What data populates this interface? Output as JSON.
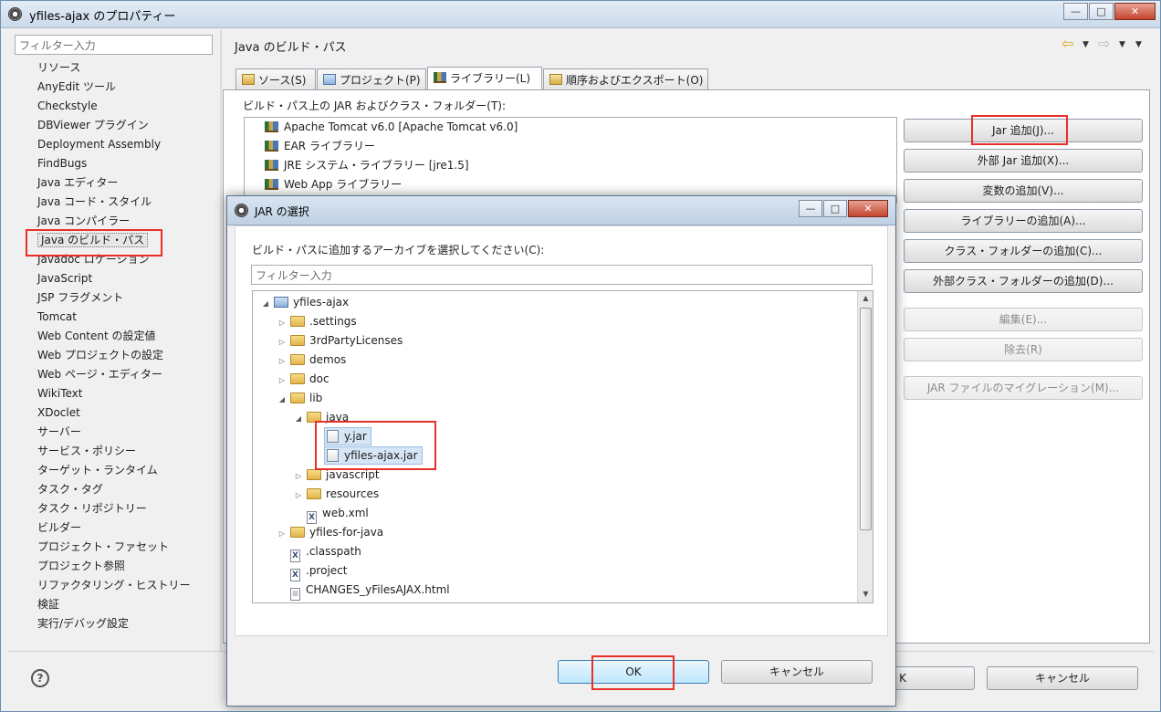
{
  "main_window": {
    "title": "yfiles-ajax のプロパティー",
    "left_filter_placeholder": "フィルター入力",
    "nav_items": [
      "リソース",
      "AnyEdit ツール",
      "Checkstyle",
      "DBViewer プラグイン",
      "Deployment Assembly",
      "FindBugs",
      "Java エディター",
      "Java コード・スタイル",
      "Java コンパイラー",
      "Java のビルド・パス",
      "Javadoc ロケーション",
      "JavaScript",
      "JSP フラグメント",
      "Tomcat",
      "Web Content の設定値",
      "Web プロジェクトの設定",
      "Web ページ・エディター",
      "WikiText",
      "XDoclet",
      "サーバー",
      "サービス・ポリシー",
      "ターゲット・ランタイム",
      "タスク・タグ",
      "タスク・リポジトリー",
      "ビルダー",
      "プロジェクト・ファセット",
      "プロジェクト参照",
      "リファクタリング・ヒストリー",
      "検証",
      "実行/デバッグ設定"
    ],
    "selected_nav": "Java のビルド・パス",
    "page_title": "Java のビルド・パス",
    "tabs": [
      "ソース(S)",
      "プロジェクト(P)",
      "ライブラリー(L)",
      "順序およびエクスポート(O)"
    ],
    "active_tab": "ライブラリー(L)",
    "classpath_label": "ビルド・パス上の JAR およびクラス・フォルダー(T):",
    "libraries": [
      "Apache Tomcat v6.0 [Apache Tomcat v6.0]",
      "EAR ライブラリー",
      "JRE システム・ライブラリー [jre1.5]",
      "Web App ライブラリー"
    ],
    "buttons": {
      "add_jars": "Jar 追加(J)...",
      "add_external_jars": "外部 Jar 追加(X)...",
      "add_variable": "変数の追加(V)...",
      "add_library": "ライブラリーの追加(A)...",
      "add_class_folder": "クラス・フォルダーの追加(C)...",
      "add_external_class_folder": "外部クラス・フォルダーの追加(D)...",
      "edit": "編集(E)...",
      "remove": "除去(R)",
      "migrate_jar": "JAR ファイルのマイグレーション(M)...",
      "ok_partial": "K",
      "cancel": "キャンセル"
    },
    "help_glyph": "?",
    "caption_buttons": {
      "minimize": "—",
      "maximize": "□",
      "close": "✕"
    }
  },
  "dialog": {
    "title": "JAR の選択",
    "prompt": "ビルド・パスに追加するアーカイブを選択してください(C):",
    "filter_placeholder": "フィルター入力",
    "tree": {
      "root": "yfiles-ajax",
      "settings": ".settings",
      "licenses": "3rdPartyLicenses",
      "demos": "demos",
      "doc": "doc",
      "lib": "lib",
      "java": "java",
      "y_jar": "y.jar",
      "yfiles_ajax_jar": "yfiles-ajax.jar",
      "javascript": "javascript",
      "resources": "resources",
      "web_xml": "web.xml",
      "yfiles_for_java": "yfiles-for-java",
      "classpath": ".classpath",
      "project": ".project",
      "changes": "CHANGES_yFilesAJAX.html"
    },
    "ok": "OK",
    "cancel": "キャンセル",
    "caption_buttons": {
      "minimize": "—",
      "maximize": "□",
      "close": "✕"
    }
  },
  "colors": {
    "highlight_box": "#e8302a",
    "selection": "#d5e6f7",
    "titlebar": "#cbdaea"
  }
}
